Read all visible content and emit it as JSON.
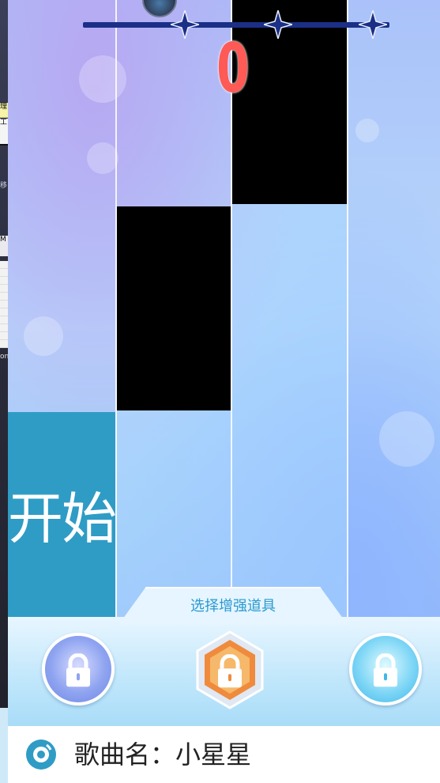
{
  "game": {
    "score": "0",
    "start_tile_label": "开始",
    "progress_stars": [
      "star",
      "star",
      "star"
    ],
    "accent_colors": {
      "start_tile": "#2f9cc5",
      "score": "#ff5a55",
      "rail": "#1b2f86",
      "title_text": "#2a9ad0"
    }
  },
  "powerups": {
    "title": "选择增强道具",
    "items": [
      {
        "name": "powerup-shield",
        "locked": true
      },
      {
        "name": "powerup-fire",
        "locked": true
      },
      {
        "name": "powerup-ice",
        "locked": true
      }
    ]
  },
  "song": {
    "label": "歌曲名：小星星",
    "icon": "music-disc-icon"
  },
  "desktop_fragments": [
    "理",
    "工",
    "移",
    "M",
    "on"
  ]
}
